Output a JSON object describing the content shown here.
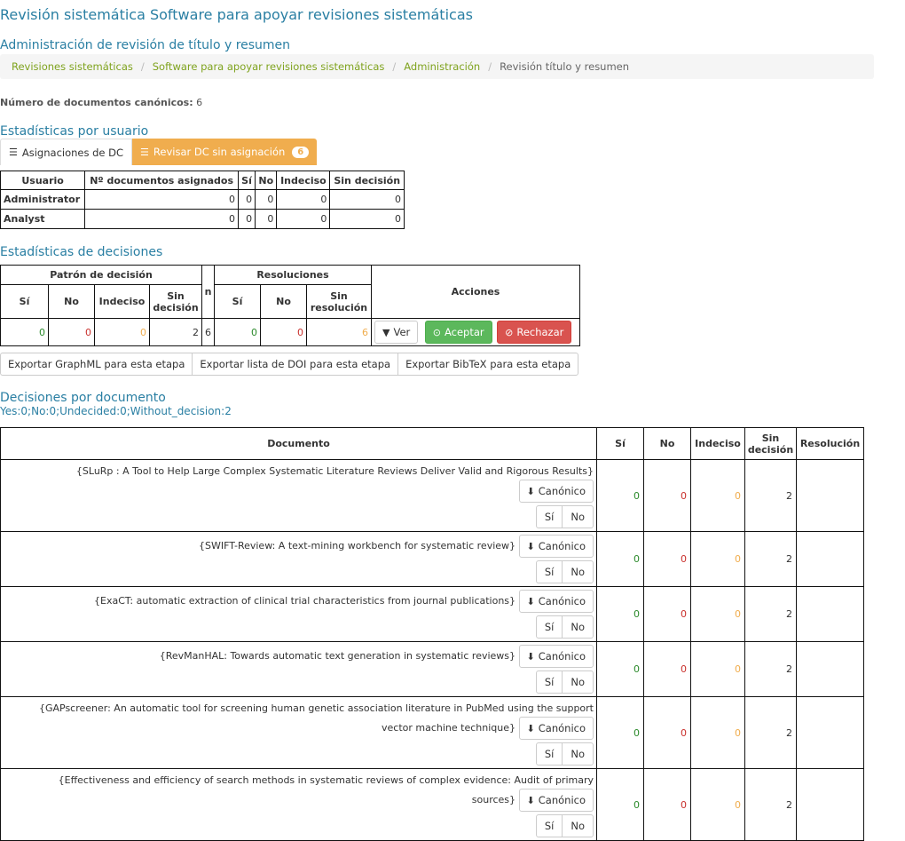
{
  "header": {
    "title": "Revisión sistemática Software para apoyar revisiones sistemáticas",
    "subtitle": "Administración de revisión de título y resumen"
  },
  "breadcrumb": [
    {
      "label": "Revisiones sistemáticas",
      "link": true
    },
    {
      "label": "Software para apoyar revisiones sistemáticas",
      "link": true
    },
    {
      "label": "Administración",
      "link": true
    },
    {
      "label": "Revisión título y resumen",
      "link": false
    }
  ],
  "canonical": {
    "label": "Número de documentos canónicos:",
    "value": "6"
  },
  "user_stats": {
    "heading": "Estadísticas por usuario",
    "tabs": [
      {
        "label": "Asignaciones de DC",
        "icon": "list-icon",
        "badge": ""
      },
      {
        "label": "Revisar DC sin asignación",
        "icon": "list-icon",
        "badge": "6"
      }
    ],
    "columns": [
      "Usuario",
      "Nº documentos asignados",
      "Sí",
      "No",
      "Indeciso",
      "Sin decisión"
    ],
    "rows": [
      [
        "Administrator",
        "0",
        "0",
        "0",
        "0",
        "0"
      ],
      [
        "Analyst",
        "0",
        "0",
        "0",
        "0",
        "0"
      ]
    ]
  },
  "decision_stats": {
    "heading": "Estadísticas de decisiones",
    "group_pattern": "Patrón de decisión",
    "col_n": "n",
    "group_resolutions": "Resoluciones",
    "col_actions": "Acciones",
    "pattern_cols": [
      "Sí",
      "No",
      "Indeciso",
      "Sin decisión"
    ],
    "resolution_cols": [
      "Sí",
      "No",
      "Sin resolución"
    ],
    "pattern_values": [
      "0",
      "0",
      "0",
      "2"
    ],
    "n_value": "6",
    "resolution_values": [
      "0",
      "0",
      "6"
    ],
    "btn_view": "Ver",
    "btn_accept": "Aceptar",
    "btn_reject": "Rechazar"
  },
  "exports": [
    "Exportar GraphML para esta etapa",
    "Exportar lista de DOI para esta etapa",
    "Exportar BibTeX para esta etapa"
  ],
  "documents": {
    "heading": "Decisiones por documento",
    "summary": "Yes:0;No:0;Undecided:0;Without_decision:2",
    "columns": [
      "Documento",
      "Sí",
      "No",
      "Indeciso",
      "Sin decisión",
      "Resolución"
    ],
    "canon_label": "Canónico",
    "yes_label": "Sí",
    "no_label": "No",
    "rows": [
      {
        "title": "{SLuRp : A Tool to Help Large Complex Systematic Literature Reviews Deliver Valid and Rigorous Results}",
        "si": "0",
        "no": "0",
        "indeciso": "0",
        "sin": "2",
        "res": ""
      },
      {
        "title": "{SWIFT-Review: A text-mining workbench for systematic review}",
        "si": "0",
        "no": "0",
        "indeciso": "0",
        "sin": "2",
        "res": ""
      },
      {
        "title": "{ExaCT: automatic extraction of clinical trial characteristics from journal publications}",
        "si": "0",
        "no": "0",
        "indeciso": "0",
        "sin": "2",
        "res": ""
      },
      {
        "title": "{RevManHAL: Towards automatic text generation in systematic reviews}",
        "si": "0",
        "no": "0",
        "indeciso": "0",
        "sin": "2",
        "res": ""
      },
      {
        "title": "{GAPscreener: An automatic tool for screening human genetic association literature in PubMed using the support vector machine technique}",
        "si": "0",
        "no": "0",
        "indeciso": "0",
        "sin": "2",
        "res": ""
      },
      {
        "title": "{Effectiveness and efficiency of search methods in systematic reviews of complex evidence: Audit of primary sources}",
        "si": "0",
        "no": "0",
        "indeciso": "0",
        "sin": "2",
        "res": ""
      }
    ]
  },
  "colors": {
    "accent": "#2a7fa3",
    "link": "#7fa31e",
    "warning": "#f0ad4e",
    "success": "#5cb85c",
    "danger": "#d9534f"
  }
}
